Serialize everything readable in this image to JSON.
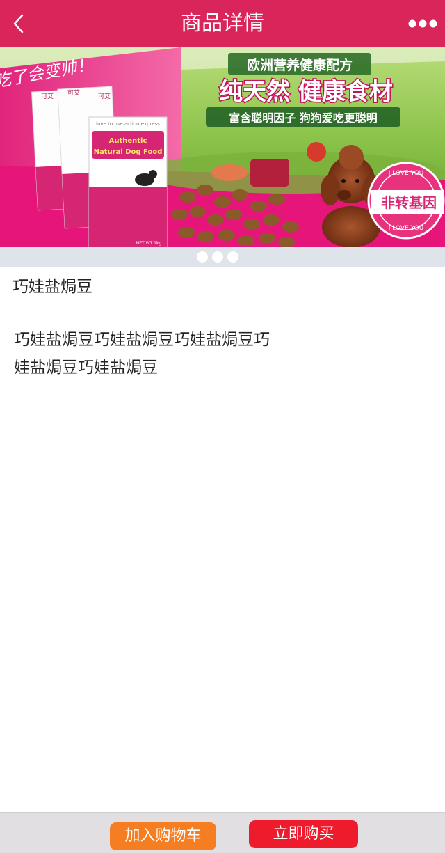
{
  "header": {
    "title": "商品详情",
    "back_icon": "chevron-left-icon",
    "more_icon": "more-dots-icon"
  },
  "banner": {
    "tagline_top": "欧洲营养健康配方",
    "headline": "纯天然 健康食材",
    "subline": "富含聪明因子  狗狗爱吃更聪明",
    "stamp_text": "非转基因",
    "stamp_ring_text": "I LOVE YOU",
    "corner_slogan": "吃了会变帅！",
    "bag_brand": "可艾",
    "bag_slogan": "love to use action express",
    "bag_title_line1": "Authentic",
    "bag_title_line2": "Natural Dog Food",
    "bag_weight": "NET WT 1kg",
    "slide_count": 3,
    "active_slide": 1
  },
  "product": {
    "title": "巧娃盐焗豆",
    "description": "巧娃盐焗豆巧娃盐焗豆巧娃盐焗豆巧娃盐焗豆巧娃盐焗豆"
  },
  "actions": {
    "add_to_cart": "加入购物车",
    "buy_now": "立即购买"
  },
  "colors": {
    "header_bg": "#d9255a",
    "cart_button": "#f57d22",
    "buy_button": "#ee1b2d"
  }
}
